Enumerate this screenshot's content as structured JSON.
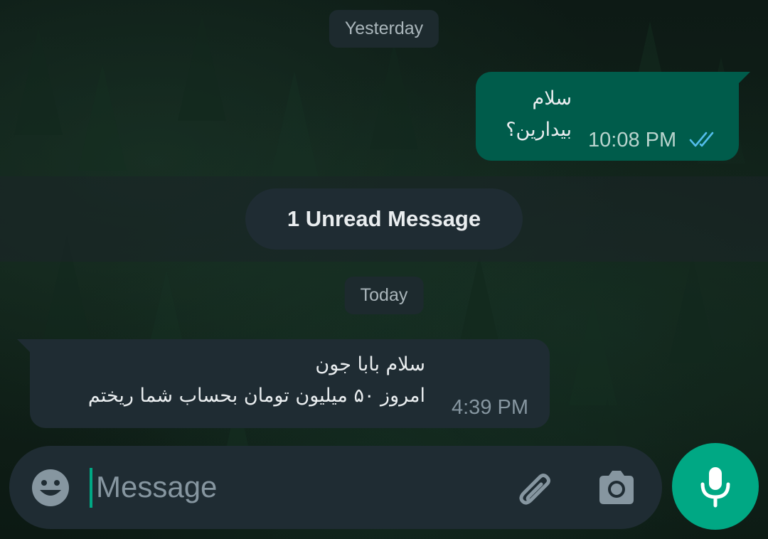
{
  "chat": {
    "date_yesterday": "Yesterday",
    "unread_label": "1 Unread Message",
    "date_today": "Today",
    "outgoing": {
      "line1": "سلام",
      "line2": "بیدارین؟",
      "time": "10:08 PM",
      "status_icon": "double-check-icon",
      "status_color": "#53bdeb"
    },
    "incoming": {
      "line1": "سلام بابا جون",
      "line2": "امروز ۵۰ میلیون تومان بحساب شما ریختم",
      "time": "4:39 PM"
    }
  },
  "composer": {
    "placeholder": "Message",
    "value": "",
    "emoji_icon": "emoji-icon",
    "attach_icon": "paperclip-icon",
    "camera_icon": "camera-icon",
    "mic_icon": "microphone-icon"
  },
  "colors": {
    "accent": "#00a884",
    "outgoing_bubble": "#005c4b",
    "incoming_bubble": "#1f2c33"
  }
}
